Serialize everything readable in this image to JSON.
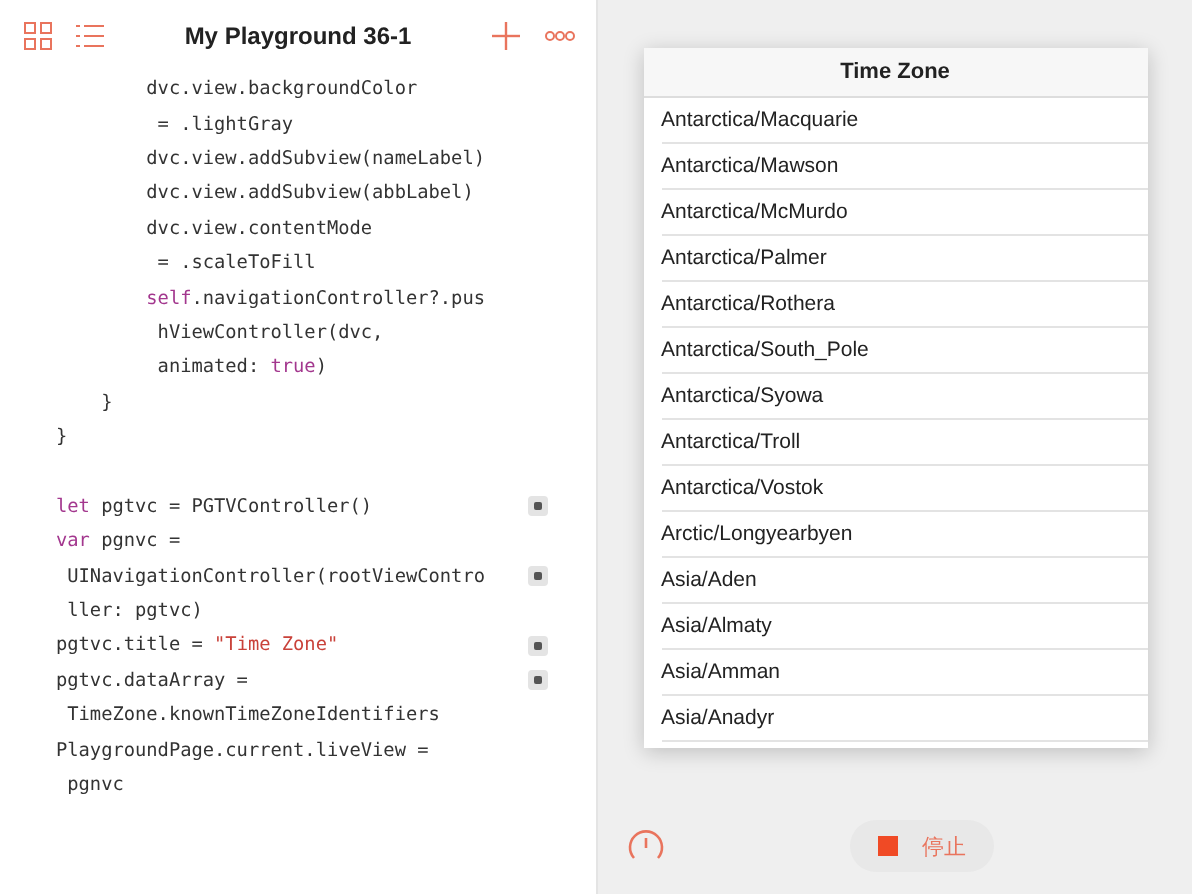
{
  "toolbar": {
    "title": "My Playground 36-1"
  },
  "code": [
    {
      "segments": [
        {
          "kind": "plain",
          "text": "        dvc.view.backgroundColor"
        }
      ],
      "result": false
    },
    {
      "segments": [
        {
          "kind": "plain",
          "text": "         = .lightGray"
        }
      ],
      "result": false
    },
    {
      "segments": [
        {
          "kind": "plain",
          "text": "        dvc.view.addSubview(nameLabel)"
        }
      ],
      "result": false
    },
    {
      "segments": [
        {
          "kind": "plain",
          "text": "        dvc.view.addSubview(abbLabel)"
        }
      ],
      "result": false
    },
    {
      "segments": [
        {
          "kind": "plain",
          "text": "        dvc.view.contentMode"
        }
      ],
      "result": false
    },
    {
      "segments": [
        {
          "kind": "plain",
          "text": "         = .scaleToFill"
        }
      ],
      "result": false
    },
    {
      "segments": [
        {
          "kind": "keyword",
          "text": "        self"
        },
        {
          "kind": "plain",
          "text": ".navigationController?.pus"
        }
      ],
      "result": false
    },
    {
      "segments": [
        {
          "kind": "plain",
          "text": "         hViewController(dvc,"
        }
      ],
      "result": false
    },
    {
      "segments": [
        {
          "kind": "plain",
          "text": "         animated: "
        },
        {
          "kind": "keyword",
          "text": "true"
        },
        {
          "kind": "plain",
          "text": ")"
        }
      ],
      "result": false
    },
    {
      "segments": [
        {
          "kind": "plain",
          "text": "    }"
        }
      ],
      "result": false
    },
    {
      "segments": [
        {
          "kind": "plain",
          "text": "}"
        }
      ],
      "result": false
    },
    {
      "result": false
    },
    {
      "segments": [
        {
          "kind": "keyword",
          "text": "let"
        },
        {
          "kind": "plain",
          "text": " pgtvc = PGTVController()"
        }
      ],
      "result": true
    },
    {
      "segments": [
        {
          "kind": "keyword",
          "text": "var"
        },
        {
          "kind": "plain",
          "text": " pgnvc ="
        }
      ],
      "result": false
    },
    {
      "segments": [
        {
          "kind": "plain",
          "text": " UINavigationController(rootViewContro"
        }
      ],
      "result": true
    },
    {
      "segments": [
        {
          "kind": "plain",
          "text": " ller: pgtvc)"
        }
      ],
      "result": false
    },
    {
      "segments": [
        {
          "kind": "plain",
          "text": "pgtvc.title = "
        },
        {
          "kind": "string",
          "text": "\"Time Zone\""
        }
      ],
      "result": true
    },
    {
      "segments": [
        {
          "kind": "plain",
          "text": "pgtvc.dataArray ="
        }
      ],
      "result": true
    },
    {
      "segments": [
        {
          "kind": "plain",
          "text": " TimeZone.knownTimeZoneIdentifiers"
        }
      ],
      "result": false
    },
    {
      "segments": [
        {
          "kind": "plain",
          "text": "PlaygroundPage.current.liveView ="
        }
      ],
      "result": false
    },
    {
      "segments": [
        {
          "kind": "plain",
          "text": " pgnvc"
        }
      ],
      "result": false
    }
  ],
  "live_view": {
    "title": "Time Zone",
    "rows": [
      "Antarctica/Macquarie",
      "Antarctica/Mawson",
      "Antarctica/McMurdo",
      "Antarctica/Palmer",
      "Antarctica/Rothera",
      "Antarctica/South_Pole",
      "Antarctica/Syowa",
      "Antarctica/Troll",
      "Antarctica/Vostok",
      "Arctic/Longyearbyen",
      "Asia/Aden",
      "Asia/Almaty",
      "Asia/Amman",
      "Asia/Anadyr"
    ]
  },
  "stop_button": {
    "label": "停止"
  }
}
